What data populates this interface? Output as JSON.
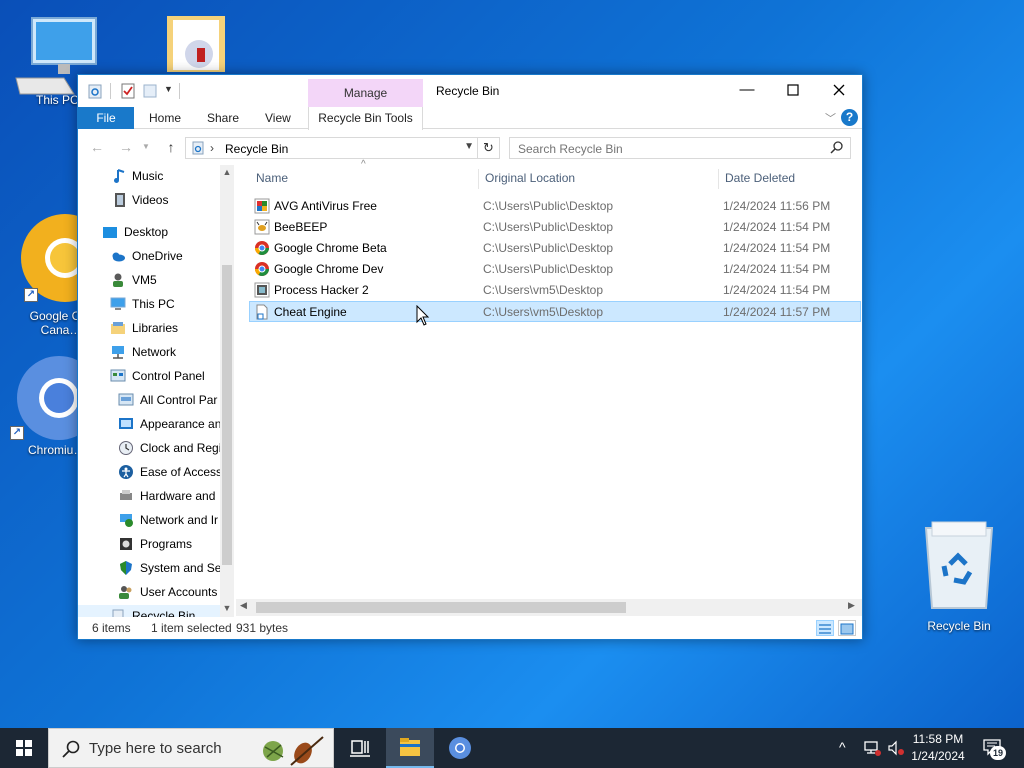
{
  "desktop": {
    "icons": [
      {
        "label": "This PC"
      },
      {
        "label": "Google C… Cana…"
      },
      {
        "label": "Chromiu…"
      },
      {
        "label": "Recycle Bin"
      }
    ]
  },
  "window": {
    "title": "Recycle Bin",
    "contextual_tab_group": "Manage",
    "ribbon_tabs": {
      "file": "File",
      "home": "Home",
      "share": "Share",
      "view": "View",
      "tools": "Recycle Bin Tools"
    },
    "help_glyph": "?",
    "address": {
      "path": "Recycle Bin"
    },
    "search": {
      "placeholder": "Search Recycle Bin"
    }
  },
  "nav_pane": {
    "items": [
      {
        "label": "Music",
        "icon": "music-icon"
      },
      {
        "label": "Videos",
        "icon": "videos-icon"
      },
      {
        "label": "Desktop",
        "icon": "desktop-folder-icon"
      },
      {
        "label": "OneDrive",
        "icon": "onedrive-icon"
      },
      {
        "label": "VM5",
        "icon": "user-icon"
      },
      {
        "label": "This PC",
        "icon": "this-pc-icon"
      },
      {
        "label": "Libraries",
        "icon": "libraries-icon"
      },
      {
        "label": "Network",
        "icon": "network-icon"
      },
      {
        "label": "Control Panel",
        "icon": "control-panel-icon"
      },
      {
        "label": "All Control Par",
        "icon": "all-control-panel-icon"
      },
      {
        "label": "Appearance an",
        "icon": "appearance-icon"
      },
      {
        "label": "Clock and Regi",
        "icon": "clock-icon"
      },
      {
        "label": "Ease of Access",
        "icon": "ease-of-access-icon"
      },
      {
        "label": "Hardware and",
        "icon": "hardware-icon"
      },
      {
        "label": "Network and Ir",
        "icon": "network-internet-icon"
      },
      {
        "label": "Programs",
        "icon": "programs-icon"
      },
      {
        "label": "System and Sec",
        "icon": "system-security-icon"
      },
      {
        "label": "User Accounts",
        "icon": "user-accounts-icon"
      },
      {
        "label": "Recycle Bin",
        "icon": "recycle-bin-icon"
      }
    ]
  },
  "file_list": {
    "columns": {
      "name": "Name",
      "location": "Original Location",
      "date": "Date Deleted"
    },
    "rows": [
      {
        "name": "AVG AntiVirus Free",
        "location": "C:\\Users\\Public\\Desktop",
        "date": "1/24/2024 11:56 PM",
        "icon": "avg-icon"
      },
      {
        "name": "BeeBEEP",
        "location": "C:\\Users\\Public\\Desktop",
        "date": "1/24/2024 11:54 PM",
        "icon": "beebeep-icon"
      },
      {
        "name": "Google Chrome Beta",
        "location": "C:\\Users\\Public\\Desktop",
        "date": "1/24/2024 11:54 PM",
        "icon": "chrome-beta-icon"
      },
      {
        "name": "Google Chrome Dev",
        "location": "C:\\Users\\Public\\Desktop",
        "date": "1/24/2024 11:54 PM",
        "icon": "chrome-dev-icon"
      },
      {
        "name": "Process Hacker 2",
        "location": "C:\\Users\\vm5\\Desktop",
        "date": "1/24/2024 11:54 PM",
        "icon": "process-hacker-icon"
      },
      {
        "name": "Cheat Engine",
        "location": "C:\\Users\\vm5\\Desktop",
        "date": "1/24/2024 11:57 PM",
        "icon": "shortcut-file-icon",
        "selected": true
      }
    ]
  },
  "status": {
    "count": "6 items",
    "selection": "1 item selected",
    "size": "931 bytes"
  },
  "taskbar": {
    "search_placeholder": "Type here to search",
    "time": "11:58 PM",
    "date": "1/24/2024",
    "notification_count": "19"
  }
}
